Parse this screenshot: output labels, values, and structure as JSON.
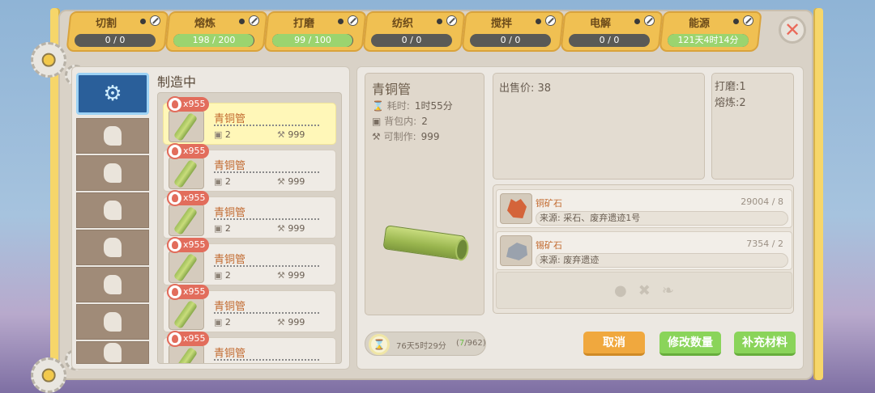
{
  "tabs": [
    {
      "title": "切割",
      "value": "0 / 0",
      "progress": 0
    },
    {
      "title": "熔炼",
      "value": "198 / 200",
      "progress": 0.99
    },
    {
      "title": "打磨",
      "value": "99 / 100",
      "progress": 0.99
    },
    {
      "title": "纺织",
      "value": "0 / 0",
      "progress": 0
    },
    {
      "title": "搅拌",
      "value": "0 / 0",
      "progress": 0
    },
    {
      "title": "电解",
      "value": "0 / 0",
      "progress": 0
    },
    {
      "title": "能源",
      "value": "121天4时14分",
      "progress": 1
    }
  ],
  "left": {
    "section_title": "制造中",
    "categories": [
      "broom-icon",
      "carrot-icon",
      "pickaxe-icon",
      "hand-icon",
      "fruit-icon",
      "stool-icon",
      "cog-icon",
      "box-icon"
    ],
    "items": [
      {
        "name": "青铜管",
        "badge": "x955",
        "bag": "2",
        "craftable": "999"
      },
      {
        "name": "青铜管",
        "badge": "x955",
        "bag": "2",
        "craftable": "999"
      },
      {
        "name": "青铜管",
        "badge": "x955",
        "bag": "2",
        "craftable": "999"
      },
      {
        "name": "青铜管",
        "badge": "x955",
        "bag": "2",
        "craftable": "999"
      },
      {
        "name": "青铜管",
        "badge": "x955",
        "bag": "2",
        "craftable": "999"
      },
      {
        "name": "青铜管",
        "badge": "x955",
        "bag": "2",
        "craftable": "999"
      }
    ]
  },
  "detail": {
    "name": "青铜管",
    "time_label": "耗时:",
    "time_value": "1时55分",
    "bag_label": "背包内:",
    "bag_value": "2",
    "craft_label": "可制作:",
    "craft_value": "999",
    "timer_text": "76天5时29分",
    "timer_count_open": "(",
    "timer_count_done": "7",
    "timer_count_rest": "/962)"
  },
  "info": {
    "price": "出售价: 38",
    "skill1": "打磨:1",
    "skill2": "熔炼:2"
  },
  "materials": [
    {
      "name": "铜矿石",
      "count": "29004 / 8",
      "source": "来源: 采石、废弃遗迹1号"
    },
    {
      "name": "锡矿石",
      "count": "7354 / 2",
      "source": "来源: 废弃遗迹"
    }
  ],
  "buttons": {
    "cancel": "取消",
    "modify": "修改数量",
    "refill": "补充材料"
  },
  "colors": {
    "tab_bg": "#f0c052",
    "progress_green": "#9bd46f",
    "cancel": "#f0a83e",
    "confirm": "#8ad45a",
    "accent_text": "#c26a2f"
  }
}
